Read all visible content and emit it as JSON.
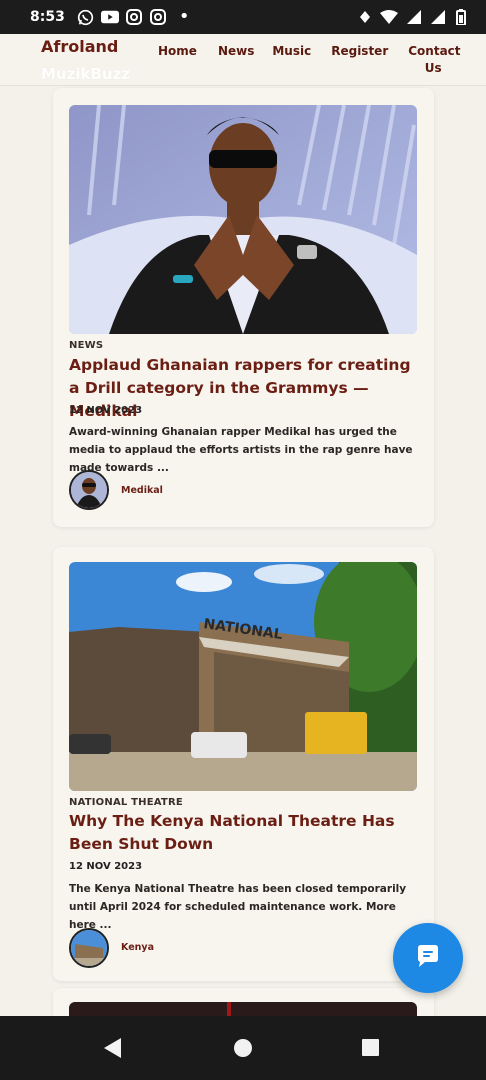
{
  "status_bar": {
    "time": "8:53",
    "left_icons": [
      "whatsapp-icon",
      "youtube-icon",
      "instagram-icon",
      "instagram-icon"
    ],
    "dot": "•",
    "right_icons": [
      "vibrate-icon",
      "wifi-icon",
      "signal-4g-icon",
      "signal-icon",
      "battery-icon"
    ]
  },
  "header": {
    "brand": "Afroland",
    "brand_sub": "MuzikBuzz",
    "nav": {
      "home": "Home",
      "news": "News",
      "music": "Music",
      "register": "Register",
      "contact": "Contact Us"
    }
  },
  "posts": [
    {
      "category": "NEWS",
      "title": "Applaud Ghanaian rappers for creating a Drill category in the Grammys — Medikal",
      "date": "12 NOV 2023",
      "excerpt": "Award-winning Ghanaian rapper Medikal has urged the media to applaud the efforts artists in the rap genre have made towards ...",
      "author": "Medikal"
    },
    {
      "category": "NATIONAL THEATRE",
      "title": "Why The Kenya National Theatre Has Been Shut Down",
      "date": "12 NOV 2023",
      "excerpt": "The Kenya National Theatre has been closed temporarily until April 2024 for scheduled maintenance work. More here ...",
      "author": "Kenya"
    }
  ],
  "colors": {
    "accent": "#6b1e14",
    "background": "#f3f1ea",
    "fab": "#1e88e5"
  },
  "chat_button": {
    "icon": "chat-bubble-icon"
  },
  "android_nav": {
    "back": "back-icon",
    "home": "home-icon",
    "recent": "recent-apps-icon"
  }
}
